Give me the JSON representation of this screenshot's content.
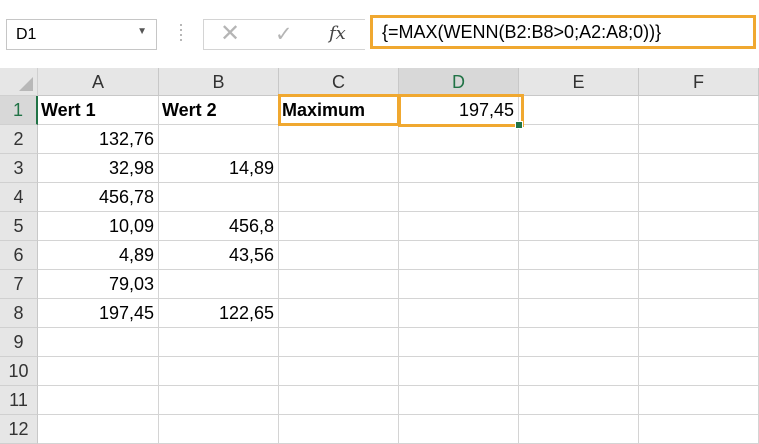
{
  "name_box": {
    "value": "D1"
  },
  "formula_bar": {
    "formula": "{=MAX(WENN(B2:B8>0;A2:A8;0))}",
    "fx_label": "fx"
  },
  "columns": [
    "A",
    "B",
    "C",
    "D",
    "E",
    "F"
  ],
  "rows": [
    "1",
    "2",
    "3",
    "4",
    "5",
    "6",
    "7",
    "8",
    "9",
    "10",
    "11",
    "12"
  ],
  "cells": {
    "A1": "Wert 1",
    "B1": "Wert 2",
    "C1": "Maximum",
    "D1": "197,45",
    "A2": "132,76",
    "A3": "32,98",
    "B3": "14,89",
    "A4": "456,78",
    "A5": "10,09",
    "B5": "456,8",
    "A6": "4,89",
    "B6": "43,56",
    "A7": "79,03",
    "A8": "197,45",
    "B8": "122,65"
  },
  "colors": {
    "accent_green": "#217346",
    "highlight_orange": "#f0a830"
  },
  "icons": {
    "cancel": "cancel-icon",
    "enter": "enter-icon",
    "function": "fx-icon"
  }
}
